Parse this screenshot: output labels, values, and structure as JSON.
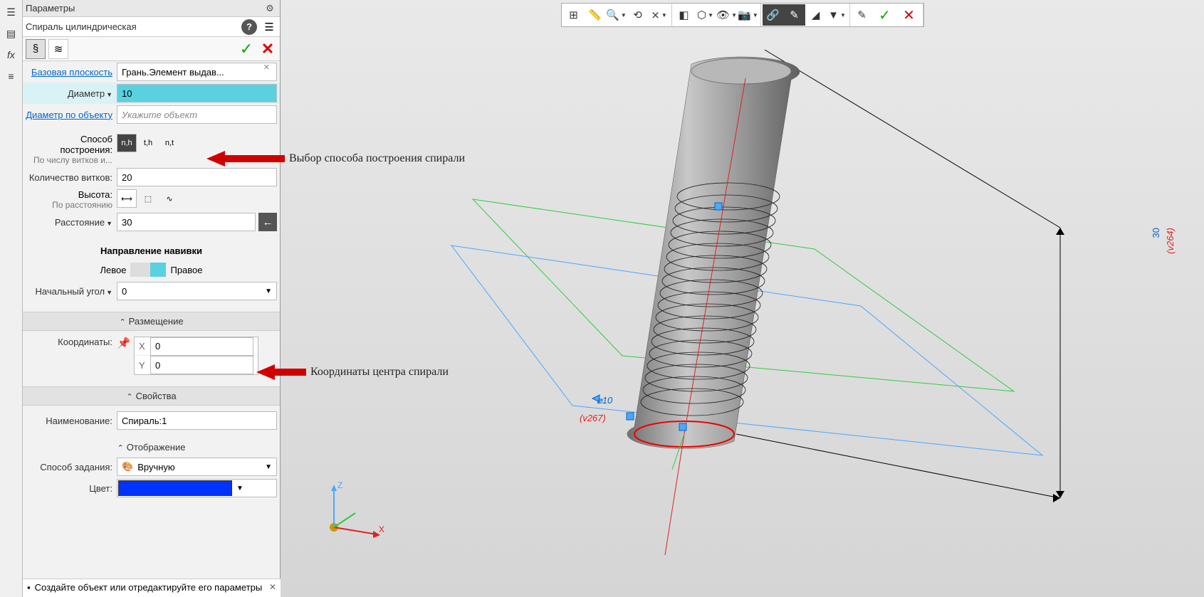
{
  "panel": {
    "title": "Параметры",
    "subtitle": "Спираль цилиндрическая",
    "base_plane_label": "Базовая плоскость",
    "base_plane_value": "Грань.Элемент выдав...",
    "diameter_label": "Диаметр",
    "diameter_value": "10",
    "diameter_obj_label": "Диаметр по объекту",
    "diameter_obj_placeholder": "Укажите объект",
    "build_label": "Способ построения:",
    "build_sub": "По числу витков и...",
    "build_opts": {
      "a": "n,h",
      "b": "t,h",
      "c": "n,t"
    },
    "turns_label": "Количество витков:",
    "turns_value": "20",
    "height_label": "Высота:",
    "height_sub": "По расстоянию",
    "distance_label": "Расстояние",
    "distance_value": "30",
    "winding_title": "Направление навивки",
    "winding_left": "Левое",
    "winding_right": "Правое",
    "start_angle_label": "Начальный угол",
    "start_angle_value": "0",
    "placement_section": "Размещение",
    "coords_label": "Координаты:",
    "coord_x": "0",
    "coord_y": "0",
    "props_section": "Свойства",
    "name_label": "Наименование:",
    "name_value": "Спираль:1",
    "display_section": "Отображение",
    "mode_label": "Способ задания:",
    "mode_value": "Вручную",
    "color_label": "Цвет:",
    "status": "Создайте объект или отредактируйте его параметры"
  },
  "annotations": {
    "build": "Выбор способа построения спирали",
    "coords": "Координаты центра спирали"
  },
  "viewport": {
    "dim_diameter": "⌀10",
    "dim_ref1": "(v267)",
    "dim_height": "30",
    "dim_ref2": "(v264)",
    "axis_x": "X",
    "axis_z": "Z"
  }
}
